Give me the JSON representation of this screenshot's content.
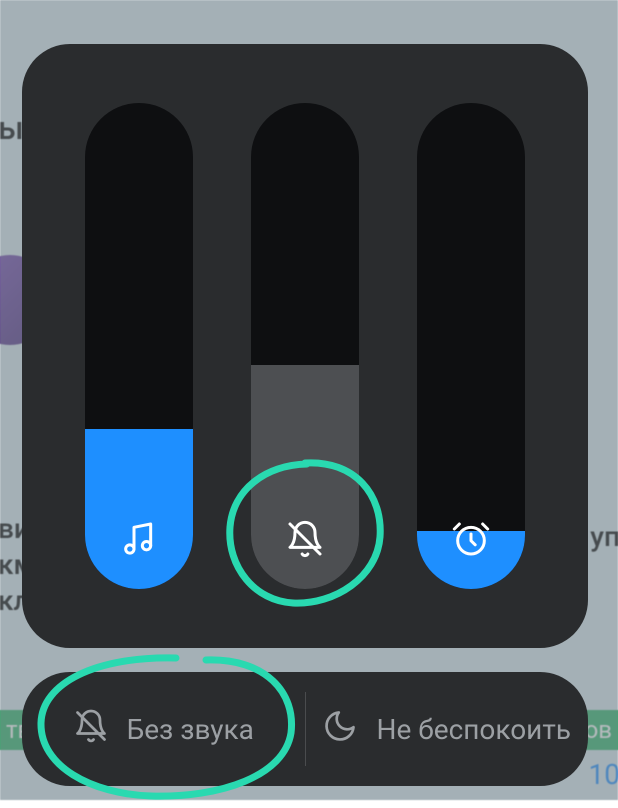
{
  "background": {
    "partial_letter": "ы",
    "text_line1": "ви",
    "text_line2": "км",
    "text_line3": "кл",
    "right_text": "уп",
    "badge1": "тв",
    "badge2": "ов",
    "number": "10"
  },
  "sliders": {
    "media": {
      "icon": "music-icon",
      "fill_percent": 33,
      "fill_color": "#1e8fff"
    },
    "ring": {
      "icon": "bell-off-icon",
      "fill_percent": 46,
      "fill_color": "#4d4f52"
    },
    "alarm": {
      "icon": "alarm-clock-icon",
      "fill_percent": 12,
      "fill_color": "#1e8fff"
    }
  },
  "bottom": {
    "mute": {
      "label": "Без звука",
      "icon": "bell-off-icon"
    },
    "dnd": {
      "label": "Не беспокоить",
      "icon": "moon-icon"
    }
  },
  "colors": {
    "accent": "#1e8fff",
    "panel": "#2a2c2e",
    "track": "#0e0f11",
    "muted_fill": "#4d4f52",
    "annotation": "#29d9b0"
  }
}
